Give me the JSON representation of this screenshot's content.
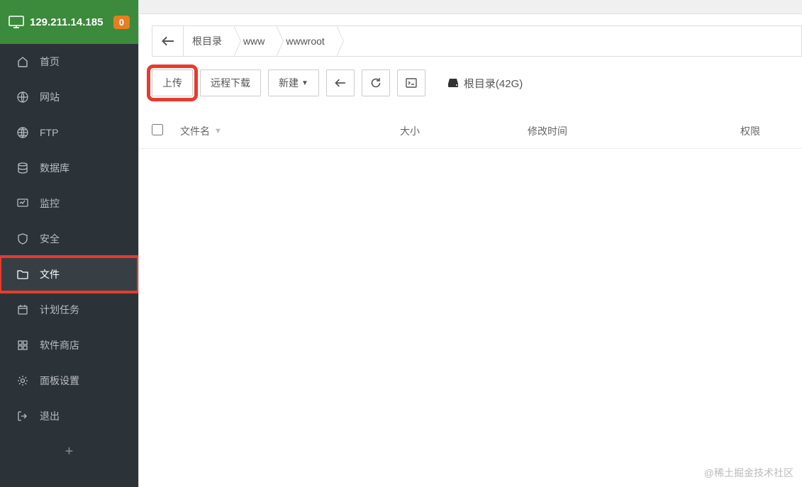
{
  "header": {
    "ip": "129.211.14.185",
    "badge": "0"
  },
  "sidebar": {
    "items": [
      {
        "label": "首页",
        "icon": "home"
      },
      {
        "label": "网站",
        "icon": "globe"
      },
      {
        "label": "FTP",
        "icon": "ftp"
      },
      {
        "label": "数据库",
        "icon": "database"
      },
      {
        "label": "监控",
        "icon": "monitor"
      },
      {
        "label": "安全",
        "icon": "shield"
      },
      {
        "label": "文件",
        "icon": "folder",
        "active": true,
        "highlighted": true
      },
      {
        "label": "计划任务",
        "icon": "calendar"
      },
      {
        "label": "软件商店",
        "icon": "apps"
      },
      {
        "label": "面板设置",
        "icon": "gear"
      },
      {
        "label": "退出",
        "icon": "logout"
      }
    ]
  },
  "breadcrumb": {
    "items": [
      "根目录",
      "www",
      "wwwroot"
    ]
  },
  "toolbar": {
    "upload": "上传",
    "remote_download": "远程下载",
    "new": "新建",
    "disk_label": "根目录(42G)"
  },
  "table": {
    "columns": {
      "name": "文件名",
      "size": "大小",
      "mtime": "修改时间",
      "perm": "权限"
    },
    "rows": []
  },
  "watermark": "@稀土掘金技术社区"
}
